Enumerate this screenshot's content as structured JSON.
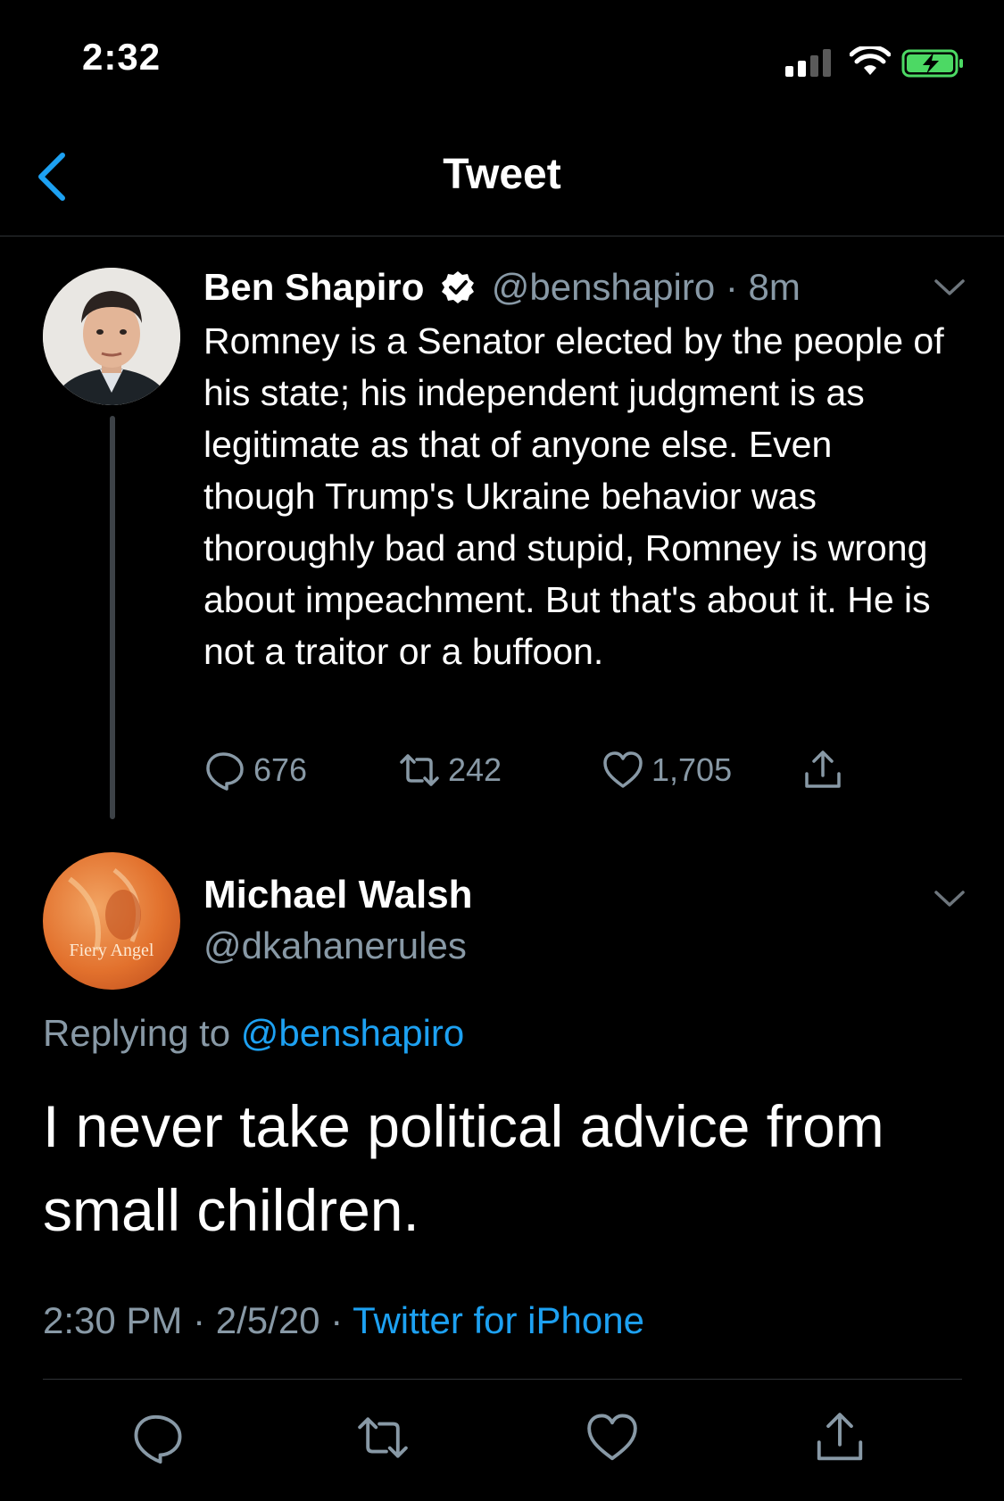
{
  "status_bar": {
    "time": "2:32"
  },
  "header": {
    "title": "Tweet"
  },
  "parent_tweet": {
    "author_name": "Ben Shapiro",
    "handle": "@benshapiro",
    "separator": "·",
    "age": "8m",
    "text": "Romney is a Senator elected by the people of his state; his independent judgment is as legitimate as that of anyone else. Even though Trump's Ukraine behavior was thoroughly bad and stupid, Romney is wrong about impeachment. But that's about it. He is not a traitor or a buffoon.",
    "reply_count": "676",
    "retweet_count": "242",
    "like_count": "1,705"
  },
  "main_tweet": {
    "author_name": "Michael Walsh",
    "handle": "@dkahanerules",
    "avatar_text": "Fiery Angel",
    "replying_label": "Replying to",
    "replying_handle": "@benshapiro",
    "text": "I never take political advice from small children.",
    "time": "2:30 PM",
    "date": "2/5/20",
    "separator": "·",
    "source": "Twitter for iPhone"
  },
  "colors": {
    "background": "#000000",
    "accent": "#1da1f2",
    "muted": "#8899a6",
    "battery": "#4cd964"
  }
}
